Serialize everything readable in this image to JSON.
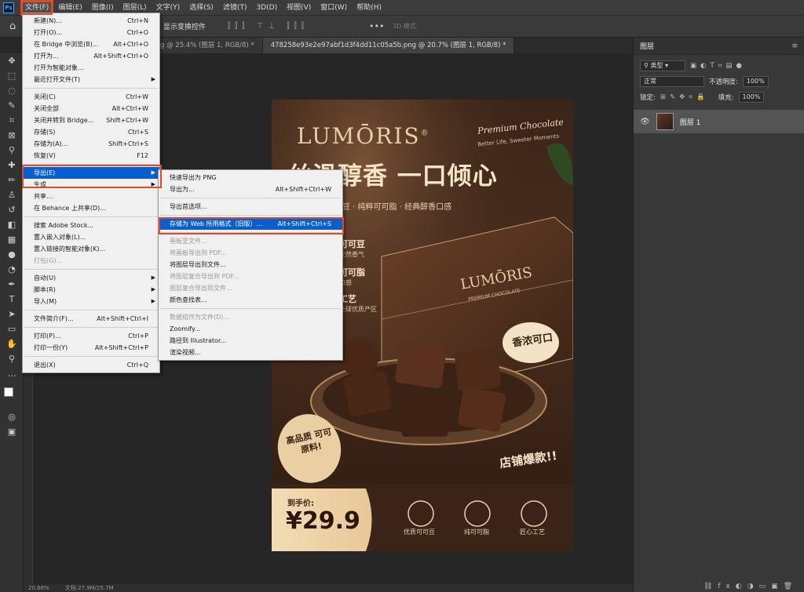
{
  "menubar": {
    "items": [
      "文件(F)",
      "编辑(E)",
      "图像(I)",
      "图层(L)",
      "文字(Y)",
      "选择(S)",
      "滤镜(T)",
      "3D(D)",
      "视图(V)",
      "窗口(W)",
      "帮助(H)"
    ]
  },
  "options": {
    "show_transform": "显示变换控件",
    "mode_3d": "3D 模式:"
  },
  "tabs": [
    "g @ 25.4% (图层 1, RGB/8) *",
    "478258e93e2e97abf1d3f4dd11c05a5b.png @ 20.7% (图层 1, RGB/8) *"
  ],
  "status": {
    "zoom": "20.66%",
    "doc": "文档:27.9M/25.7M"
  },
  "layers_panel": {
    "title": "图层",
    "filter_kind": "类型",
    "blend_mode": "正常",
    "opacity_label": "不透明度:",
    "opacity_value": "100%",
    "lock_label": "锁定:",
    "fill_label": "填充:",
    "fill_value": "100%",
    "layer_name": "图层 1"
  },
  "file_menu": [
    {
      "label": "新建(N)...",
      "shortcut": "Ctrl+N"
    },
    {
      "label": "打开(O)...",
      "shortcut": "Ctrl+O"
    },
    {
      "label": "在 Bridge 中浏览(B)...",
      "shortcut": "Alt+Ctrl+O"
    },
    {
      "label": "打开为...",
      "shortcut": "Alt+Shift+Ctrl+O"
    },
    {
      "label": "打开为智能对象...",
      "shortcut": ""
    },
    {
      "label": "最近打开文件(T)",
      "shortcut": "",
      "submenu": true
    },
    {
      "sep": true
    },
    {
      "label": "关闭(C)",
      "shortcut": "Ctrl+W"
    },
    {
      "label": "关闭全部",
      "shortcut": "Alt+Ctrl+W"
    },
    {
      "label": "关闭并转到 Bridge...",
      "shortcut": "Shift+Ctrl+W"
    },
    {
      "label": "存储(S)",
      "shortcut": "Ctrl+S"
    },
    {
      "label": "存储为(A)...",
      "shortcut": "Shift+Ctrl+S"
    },
    {
      "label": "恢复(V)",
      "shortcut": "F12"
    },
    {
      "sep": true
    },
    {
      "label": "导出(E)",
      "shortcut": "",
      "submenu": true,
      "highlight": true
    },
    {
      "label": "生成",
      "shortcut": "",
      "submenu": true
    },
    {
      "label": "共享...",
      "shortcut": ""
    },
    {
      "label": "在 Behance 上共享(D)...",
      "shortcut": ""
    },
    {
      "sep": true
    },
    {
      "label": "搜索 Adobe Stock...",
      "shortcut": ""
    },
    {
      "label": "置入嵌入对象(L)...",
      "shortcut": ""
    },
    {
      "label": "置入链接的智能对象(K)...",
      "shortcut": ""
    },
    {
      "label": "打包(G)...",
      "shortcut": "",
      "disabled": true
    },
    {
      "sep": true
    },
    {
      "label": "自动(U)",
      "shortcut": "",
      "submenu": true
    },
    {
      "label": "脚本(R)",
      "shortcut": "",
      "submenu": true
    },
    {
      "label": "导入(M)",
      "shortcut": "",
      "submenu": true
    },
    {
      "sep": true
    },
    {
      "label": "文件简介(F)...",
      "shortcut": "Alt+Shift+Ctrl+I"
    },
    {
      "sep": true
    },
    {
      "label": "打印(P)...",
      "shortcut": "Ctrl+P"
    },
    {
      "label": "打印一份(Y)",
      "shortcut": "Alt+Shift+Ctrl+P"
    },
    {
      "sep": true
    },
    {
      "label": "退出(X)",
      "shortcut": "Ctrl+Q"
    }
  ],
  "export_menu": [
    {
      "label": "快速导出为 PNG",
      "shortcut": ""
    },
    {
      "label": "导出为...",
      "shortcut": "Alt+Shift+Ctrl+W"
    },
    {
      "sep": true
    },
    {
      "label": "导出首选项...",
      "shortcut": ""
    },
    {
      "sep": true
    },
    {
      "label": "存储为 Web 所用格式（旧版）...",
      "shortcut": "Alt+Shift+Ctrl+S",
      "highlight": true
    },
    {
      "sep": true
    },
    {
      "label": "画板至文件...",
      "shortcut": "",
      "disabled": true
    },
    {
      "label": "将画板导出到 PDF...",
      "shortcut": "",
      "disabled": true
    },
    {
      "label": "将图层导出到文件...",
      "shortcut": ""
    },
    {
      "label": "将图层复合导出到 PDF...",
      "shortcut": "",
      "disabled": true
    },
    {
      "label": "图层复合导出到文件...",
      "shortcut": "",
      "disabled": true
    },
    {
      "label": "颜色查找表...",
      "shortcut": ""
    },
    {
      "sep": true
    },
    {
      "label": "数据组作为文件(D)...",
      "shortcut": "",
      "disabled": true
    },
    {
      "label": "Zoomify...",
      "shortcut": ""
    },
    {
      "label": "路径到 Illustrator...",
      "shortcut": ""
    },
    {
      "label": "渲染视频...",
      "shortcut": ""
    }
  ],
  "poster": {
    "brand": "LUMŌRIS",
    "reg": "®",
    "premium": "Premium Chocolate",
    "tagline": "Better Life, Sweeter Moments",
    "headline": "丝滑醇香 一口倾心",
    "subline": "可可豆 · 纯粹可可脂 · 经典醇香口感",
    "feat1_title": "可可豆",
    "feat1_sub": "天然香气",
    "feat2_title": "可可脂",
    "feat2_sub": "口感",
    "feat3_title": "工艺",
    "feat3_sub": "全球优质产区",
    "box_brand": "LUMŌRIS",
    "box_sub": "PREMIUM CHOCOLATE",
    "badge": "香浓可口",
    "seal": "高品质 可可原料!",
    "hot": "店铺爆款!!",
    "price_label": "到手价:",
    "price": "¥29.9",
    "icon1": "优质可可豆",
    "icon2": "纯可可脂",
    "icon3": "匠心工艺"
  }
}
